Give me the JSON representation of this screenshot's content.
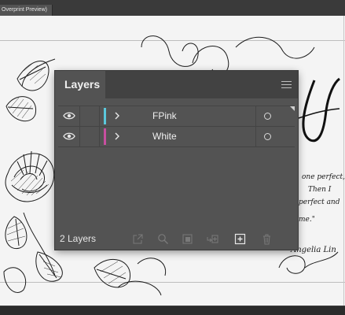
{
  "document_tab": {
    "title": "Overprint Preview)"
  },
  "artwork": {
    "initial_letter": "A",
    "script_lines": [
      "one perfect,",
      "Then I",
      "perfect and",
      "me.\"",
      "Angelia Lin"
    ]
  },
  "layers_panel": {
    "tab_label": "Layers",
    "menu_icon": "hamburger-menu-icon",
    "layers": [
      {
        "name": "FPink",
        "color": "#5bc8dc",
        "visible": true
      },
      {
        "name": "White",
        "color": "#c84fa0",
        "visible": true
      }
    ],
    "footer": {
      "layer_count": "2 Layers",
      "buttons": [
        "export-icon",
        "search-icon",
        "clipping-mask-icon",
        "new-sublayer-icon",
        "new-layer-icon",
        "delete-icon"
      ]
    }
  }
}
